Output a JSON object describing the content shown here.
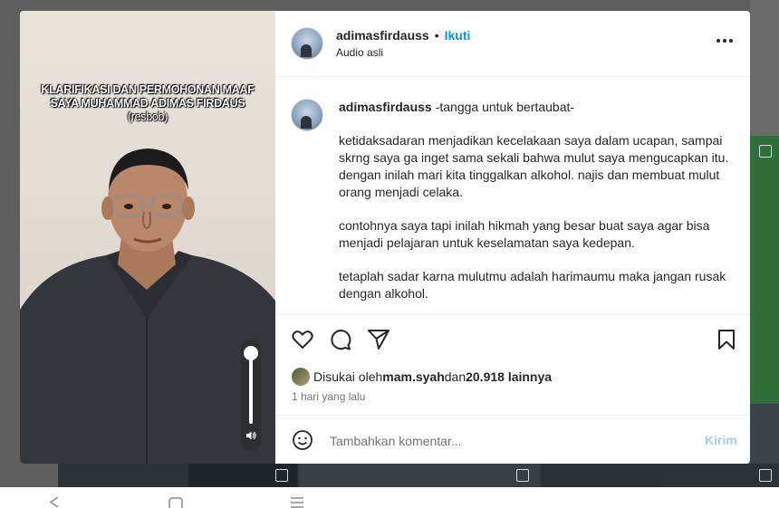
{
  "post": {
    "username": "adimasfirdauss",
    "follow_label": "Ikuti",
    "audio_label": "Audio asli",
    "separator": "•"
  },
  "media": {
    "overlay_line1": "KLARIFIKASI DAN PERMOHONAN MAAF",
    "overlay_line2": "SAYA MUHAMMAD ADIMAS FIRDAUS",
    "overlay_line3": "(resbob)",
    "volume_level": 0.95
  },
  "caption": {
    "username": "adimasfirdauss",
    "title": "-tangga untuk bertaubat-",
    "paragraphs": [
      "ketidaksadaran menjadikan kecelakaan saya dalam ucapan, sampai skrng saya ga inget sama sekali bahwa mulut saya mengucapkan itu. dengan inilah mari kita tinggalkan alkohol. najis dan membuat mulut orang menjadi celaka.",
      "contohnya saya tapi inilah hikmah yang besar buat saya agar bisa menjadi pelajaran untuk keselamatan saya kedepan.",
      "tetaplah sadar karna mulutmu adalah harimaumu maka jangan rusak dengan alkohol."
    ]
  },
  "likes": {
    "prefix": "Disukai oleh ",
    "user": "mam.syah",
    "middle": " dan ",
    "count": "20.918 lainnya",
    "time": "1 hari yang lalu"
  },
  "comment_bar": {
    "placeholder": "Tambahkan komentar...",
    "send_label": "Kirim"
  },
  "colors": {
    "accent": "#0095f6",
    "send_disabled": "#a8cdf5",
    "text": "#262626",
    "muted": "#737373"
  },
  "icons": [
    "heart-icon",
    "comment-icon",
    "share-icon",
    "bookmark-icon",
    "more-icon",
    "emoji-icon",
    "volume-icon",
    "back-icon",
    "home-icon",
    "recent-apps-icon"
  ]
}
